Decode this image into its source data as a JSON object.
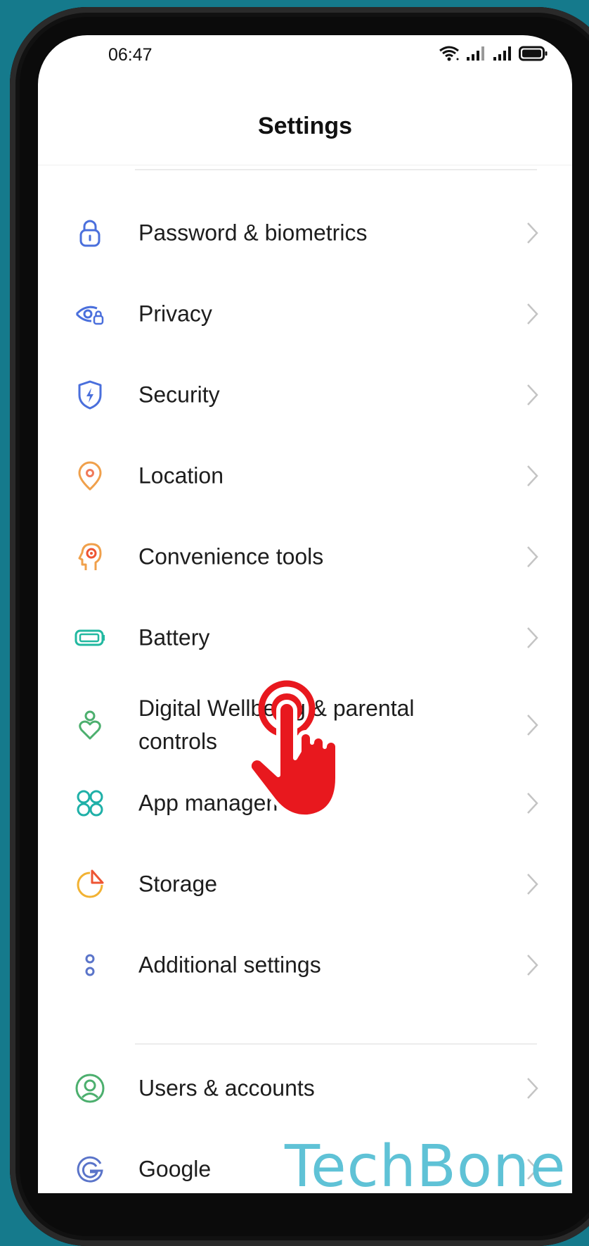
{
  "status": {
    "time": "06:47",
    "icons": [
      "wifi-icon",
      "signal-icon",
      "signal-icon",
      "battery-status-icon"
    ]
  },
  "header": {
    "title": "Settings"
  },
  "settings": [
    {
      "label": "Password & biometrics",
      "icon": "lock-icon",
      "color": "#4a6fdc"
    },
    {
      "label": "Privacy",
      "icon": "privacy-eye-icon",
      "color": "#4a6fdc"
    },
    {
      "label": "Security",
      "icon": "shield-icon",
      "color": "#4a6fdc"
    },
    {
      "label": "Location",
      "icon": "location-pin-icon",
      "color": "#f0a04b"
    },
    {
      "label": "Convenience tools",
      "icon": "convenience-head-icon",
      "color": "#ee7d35"
    },
    {
      "label": "Battery",
      "icon": "battery-icon",
      "color": "#22b8a0"
    },
    {
      "label": "Digital Wellbeing & parental controls",
      "icon": "wellbeing-heart-icon",
      "color": "#4caf6e"
    },
    {
      "label": "App management",
      "icon": "app-grid-icon",
      "color": "#1fb0a8"
    },
    {
      "label": "Storage",
      "icon": "storage-pie-icon",
      "color": "#f2b233"
    },
    {
      "label": "Additional settings",
      "icon": "dots-icon",
      "color": "#5a74c9"
    },
    {
      "label": "Users & accounts",
      "icon": "user-icon",
      "color": "#4caf6e"
    },
    {
      "label": "Google",
      "icon": "google-icon",
      "color": "#5a74c9"
    }
  ],
  "overlay": {
    "watermark": "TechBone",
    "tap_icon": "tap-hand-icon",
    "tap_color": "#e8181e"
  },
  "colors": {
    "background": "#157a8c",
    "chevron": "#c4c4c4"
  }
}
